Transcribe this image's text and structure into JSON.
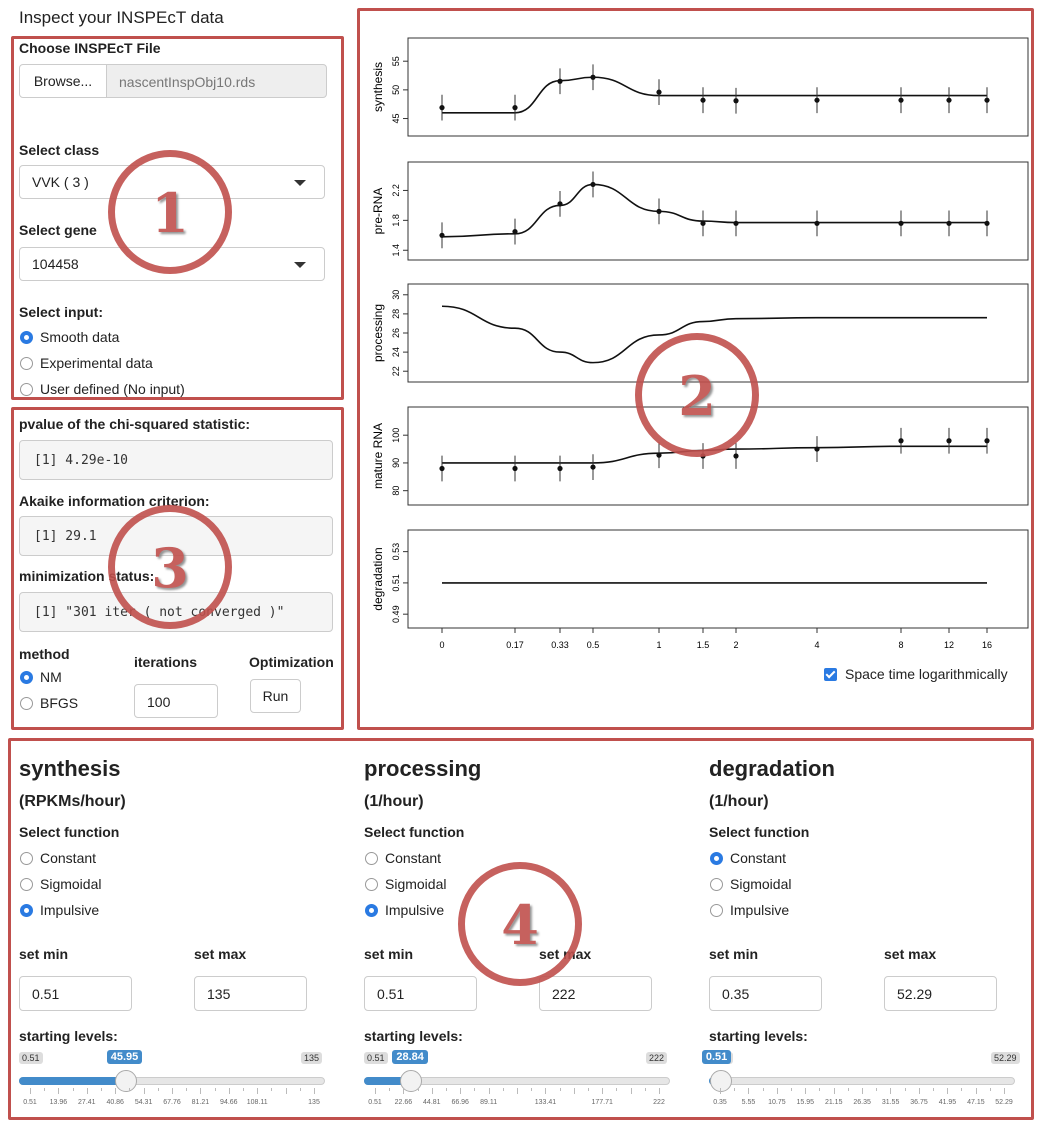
{
  "page_title": "Inspect your INSPEcT data",
  "file": {
    "label": "Choose INSPEcT File",
    "browse": "Browse...",
    "filename": "nascentInspObj10.rds"
  },
  "class": {
    "label": "Select class",
    "value": "VVK ( 3 )"
  },
  "gene": {
    "label": "Select gene",
    "value": "104458"
  },
  "input": {
    "label": "Select input:",
    "options": [
      "Smooth data",
      "Experimental data",
      "User defined (No input)"
    ],
    "selected": 0
  },
  "stats": {
    "pvalue_label": "pvalue of the chi-squared statistic:",
    "pvalue": "[1] 4.29e-10",
    "aic_label": "Akaike information criterion:",
    "aic": "[1] 29.1",
    "min_label": "minimization status:",
    "min": "[1] \"301 iter ( not converged )\""
  },
  "method": {
    "label": "method",
    "options": [
      "NM",
      "BFGS"
    ],
    "selected": 0,
    "iter_label": "iterations",
    "iter_value": "100",
    "opt_label": "Optimization",
    "run": "Run"
  },
  "annotations": [
    "1",
    "2",
    "3",
    "4"
  ],
  "plot": {
    "xticks": [
      "0",
      "0.17",
      "0.33",
      "0.5",
      "1",
      "1.5",
      "2",
      "4",
      "8",
      "12",
      "16"
    ],
    "panels": [
      {
        "ylabel": "synthesis",
        "yticks": [
          "45",
          "50",
          "55"
        ],
        "ylim": [
          43,
          58
        ],
        "points": [
          46.9,
          46.9,
          51.5,
          52.2,
          49.6,
          48.2,
          48.1,
          48.2,
          48.2,
          48.2,
          48.2
        ],
        "curve": [
          46,
          46,
          51.6,
          52.2,
          49,
          49,
          49,
          49,
          49,
          49,
          49
        ]
      },
      {
        "ylabel": "pre-RNA",
        "yticks": [
          "1.4",
          "1.8",
          "2.2"
        ],
        "ylim": [
          1.35,
          2.5
        ],
        "points": [
          1.6,
          1.65,
          2.02,
          2.28,
          1.92,
          1.76,
          1.76,
          1.76,
          1.76,
          1.76,
          1.76
        ],
        "curve": [
          1.58,
          1.62,
          2.0,
          2.28,
          1.92,
          1.79,
          1.77,
          1.77,
          1.77,
          1.77,
          1.77
        ]
      },
      {
        "ylabel": "processing",
        "yticks": [
          "22",
          "24",
          "26",
          "28",
          "30"
        ],
        "ylim": [
          21.5,
          30.5
        ],
        "points": [],
        "curve": [
          28.8,
          26.5,
          24,
          22.9,
          25.8,
          27.2,
          27.5,
          27.6,
          27.6,
          27.6,
          27.6
        ]
      },
      {
        "ylabel": "mature RNA",
        "yticks": [
          "80",
          "90",
          "100"
        ],
        "ylim": [
          77,
          108
        ],
        "points": [
          88,
          88,
          88,
          88.5,
          92.8,
          92.5,
          92.5,
          95,
          98,
          98,
          98
        ],
        "curve": [
          90,
          90,
          90,
          90,
          93.5,
          94.5,
          95,
          95.5,
          96,
          96,
          96
        ]
      },
      {
        "ylabel": "degradation",
        "yticks": [
          "0.49",
          "0.51",
          "0.53"
        ],
        "ylim": [
          0.485,
          0.54
        ],
        "points": [],
        "curve": [
          0.51,
          0.51,
          0.51,
          0.51,
          0.51,
          0.51,
          0.51,
          0.51,
          0.51,
          0.51,
          0.51
        ]
      }
    ],
    "log_label": "Space time logarithmically"
  },
  "rates": [
    {
      "title": "synthesis",
      "unit": "(RPKMs/hour)",
      "fn_label": "Select function",
      "options": [
        "Constant",
        "Sigmoidal",
        "Impulsive"
      ],
      "selected": 2,
      "min_label": "set min",
      "max_label": "set max",
      "min": "0.51",
      "max": "135",
      "levels_label": "starting levels:",
      "slider_min": "0.51",
      "slider_max": "135",
      "slider_val": "45.95",
      "fraction": 0.337,
      "ticks": [
        "0.51",
        "13.96",
        "27.41",
        "40.86",
        "54.31",
        "67.76",
        "81.21",
        "94.66",
        "108.11",
        "135"
      ]
    },
    {
      "title": "processing",
      "unit": "(1/hour)",
      "fn_label": "Select function",
      "options": [
        "Constant",
        "Sigmoidal",
        "Impulsive"
      ],
      "selected": 2,
      "min_label": "set min",
      "max_label": "set max",
      "min": "0.51",
      "max": "222",
      "levels_label": "starting levels:",
      "slider_min": "0.51",
      "slider_max": "222",
      "slider_val": "28.84",
      "fraction": 0.128,
      "ticks": [
        "0.51",
        "22.66",
        "44.81",
        "66.96",
        "89.11",
        "133.41",
        "177.71",
        "222"
      ]
    },
    {
      "title": "degradation",
      "unit": "(1/hour)",
      "fn_label": "Select function",
      "options": [
        "Constant",
        "Sigmoidal",
        "Impulsive"
      ],
      "selected": 0,
      "min_label": "set min",
      "max_label": "set max",
      "min": "0.35",
      "max": "52.29",
      "levels_label": "starting levels:",
      "slider_min": "0.51",
      "slider_max": "52.29",
      "slider_val": "0.51",
      "fraction": 0.003,
      "ticks": [
        "0.35",
        "5.55",
        "10.75",
        "15.95",
        "21.15",
        "26.35",
        "31.55",
        "36.75",
        "41.95",
        "47.15",
        "52.29"
      ]
    }
  ],
  "colors": {
    "accent": "#2a7ae2",
    "frame": "#c0504d",
    "slider": "#428bca"
  }
}
